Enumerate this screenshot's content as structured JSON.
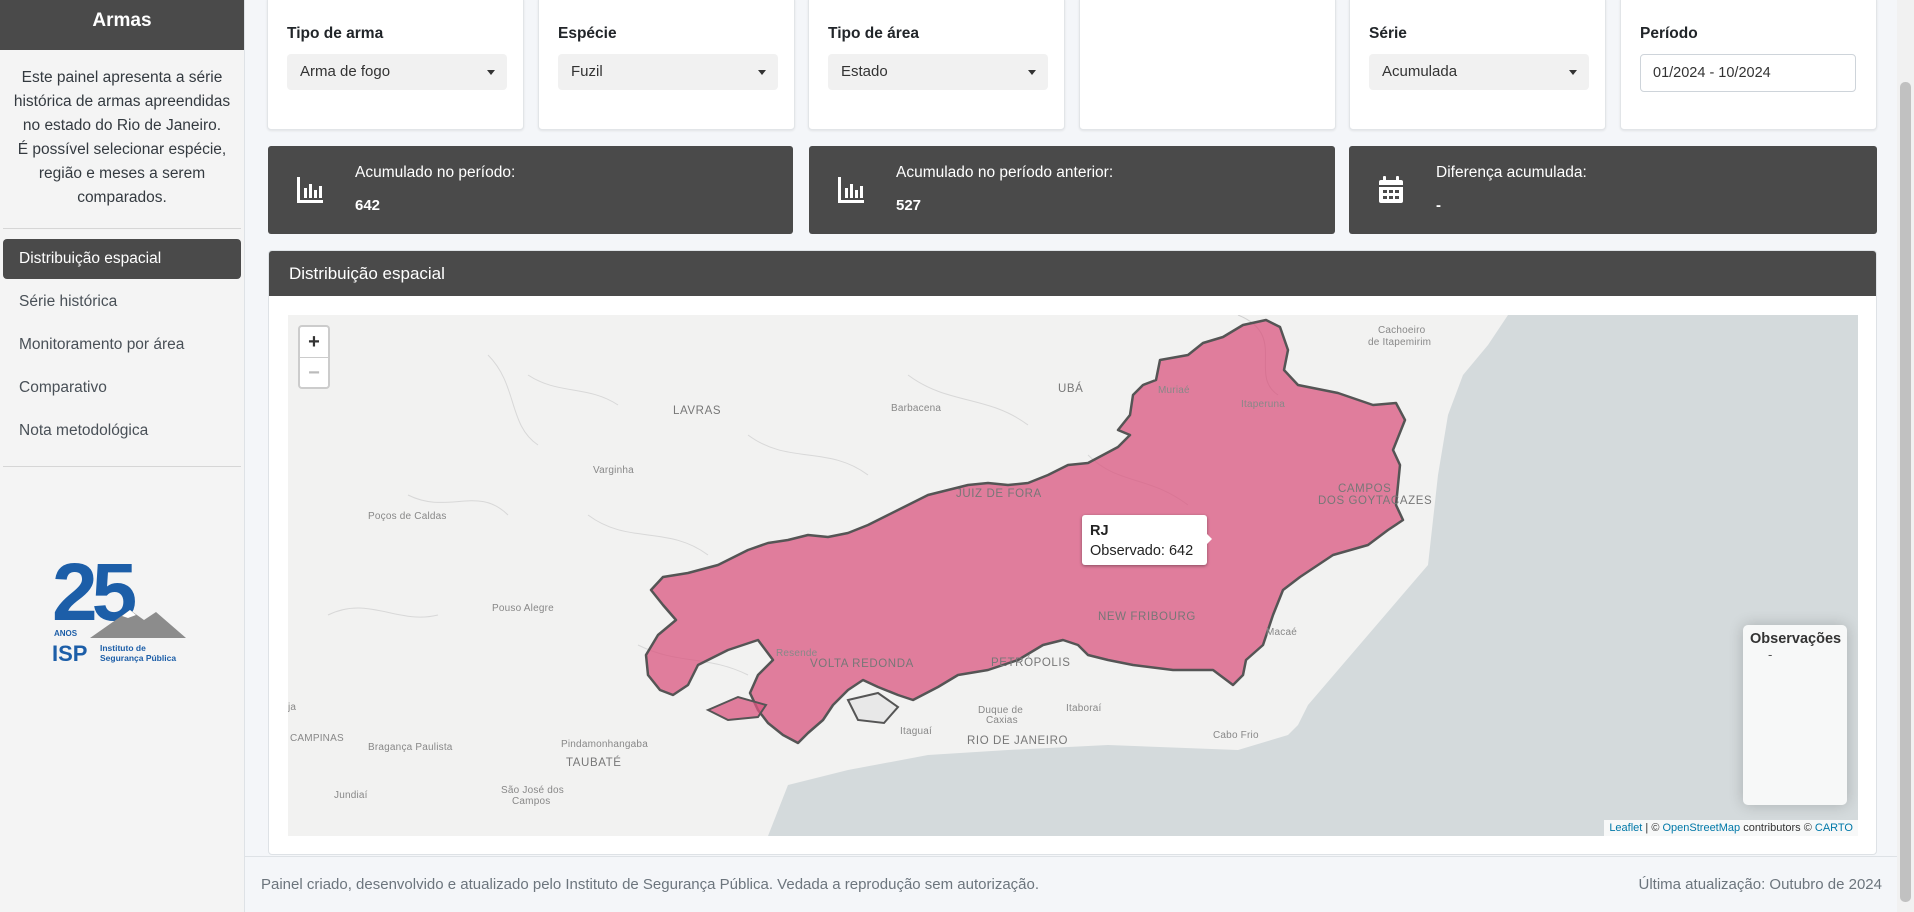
{
  "sidebar": {
    "brand": "Armas",
    "description": "Este painel apresenta a série histórica de armas apreendidas no estado do Rio de Janeiro.",
    "description2": "É possível selecionar espécie, região e meses a serem comparados.",
    "items": [
      {
        "label": "Distribuição espacial",
        "active": true
      },
      {
        "label": "Série histórica"
      },
      {
        "label": "Monitoramento por área"
      },
      {
        "label": "Comparativo"
      },
      {
        "label": "Nota metodológica"
      }
    ],
    "logo": {
      "number": "25",
      "anos": "ANOS",
      "org": "ISP",
      "org_line1": "Instituto de",
      "org_line2": "Segurança Pública"
    }
  },
  "filters": {
    "tipo_arma": {
      "label": "Tipo de arma",
      "value": "Arma de fogo"
    },
    "especie": {
      "label": "Espécie",
      "value": "Fuzil"
    },
    "tipo_area": {
      "label": "Tipo de área",
      "value": "Estado"
    },
    "serie": {
      "label": "Série",
      "value": "Acumulada"
    },
    "periodo": {
      "label": "Período",
      "value": "01/2024 - 10/2024"
    }
  },
  "stats": [
    {
      "label": "Acumulado no período:",
      "value": "642",
      "icon": "bar-chart-icon"
    },
    {
      "label": "Acumulado no período anterior:",
      "value": "527",
      "icon": "bar-chart-icon"
    },
    {
      "label": "Diferença acumulada:",
      "value": "-",
      "icon": "calendar-icon"
    }
  ],
  "map": {
    "title": "Distribuição espacial",
    "zoom_in": "+",
    "zoom_out": "−",
    "tooltip": {
      "title": "RJ",
      "text": "Observado: 642"
    },
    "legend": {
      "title": "Observações",
      "value": "-"
    },
    "attribution": {
      "leaflet": "Leaflet",
      "sep1": " | © ",
      "osm": "OpenStreetMap",
      "contrib": " contributors © ",
      "carto": "CARTO"
    },
    "region_color": "#d9567f",
    "places": {
      "cachoeiro": "Cachoeiro",
      "itapemirim": "de Itapemirim",
      "uba": "UBÁ",
      "muriae": "Muriaé",
      "lavras": "LAVRAS",
      "barbacena": "Barbacena",
      "itaperuna": "Itaperuna",
      "varginha": "Varginha",
      "campos1": "CAMPOS",
      "campos2": "DOS GOYTACAZES",
      "juiz": "JUIZ DE FORA",
      "pocos": "Poços de Caldas",
      "pouso": "Pouso Alegre",
      "nova_friburgo": "NEW FRIBOURG",
      "macae": "Macaé",
      "resende": "Resende",
      "volta": "VOLTA REDONDA",
      "petropolis": "PETRÓPOLIS",
      "duque1": "Duque de",
      "duque2": "Caxias",
      "itaborai": "Itaboraí",
      "ja": "ja",
      "campinas": "CAMPINAS",
      "braganca": "Bragança Paulista",
      "pinda": "Pindamonhangaba",
      "itaguai": "Itaguaí",
      "rio": "RIO DE JANEIRO",
      "cabo": "Cabo Frio",
      "taubate": "TAUBATÉ",
      "sjc1": "São José dos",
      "sjc2": "Campos",
      "jundiai": "Jundiaí"
    }
  },
  "footer": {
    "left": "Painel criado, desenvolvido e atualizado pelo Instituto de Segurança Pública. Vedada a reprodução sem autorização.",
    "right": "Última atualização: Outubro de 2024"
  }
}
